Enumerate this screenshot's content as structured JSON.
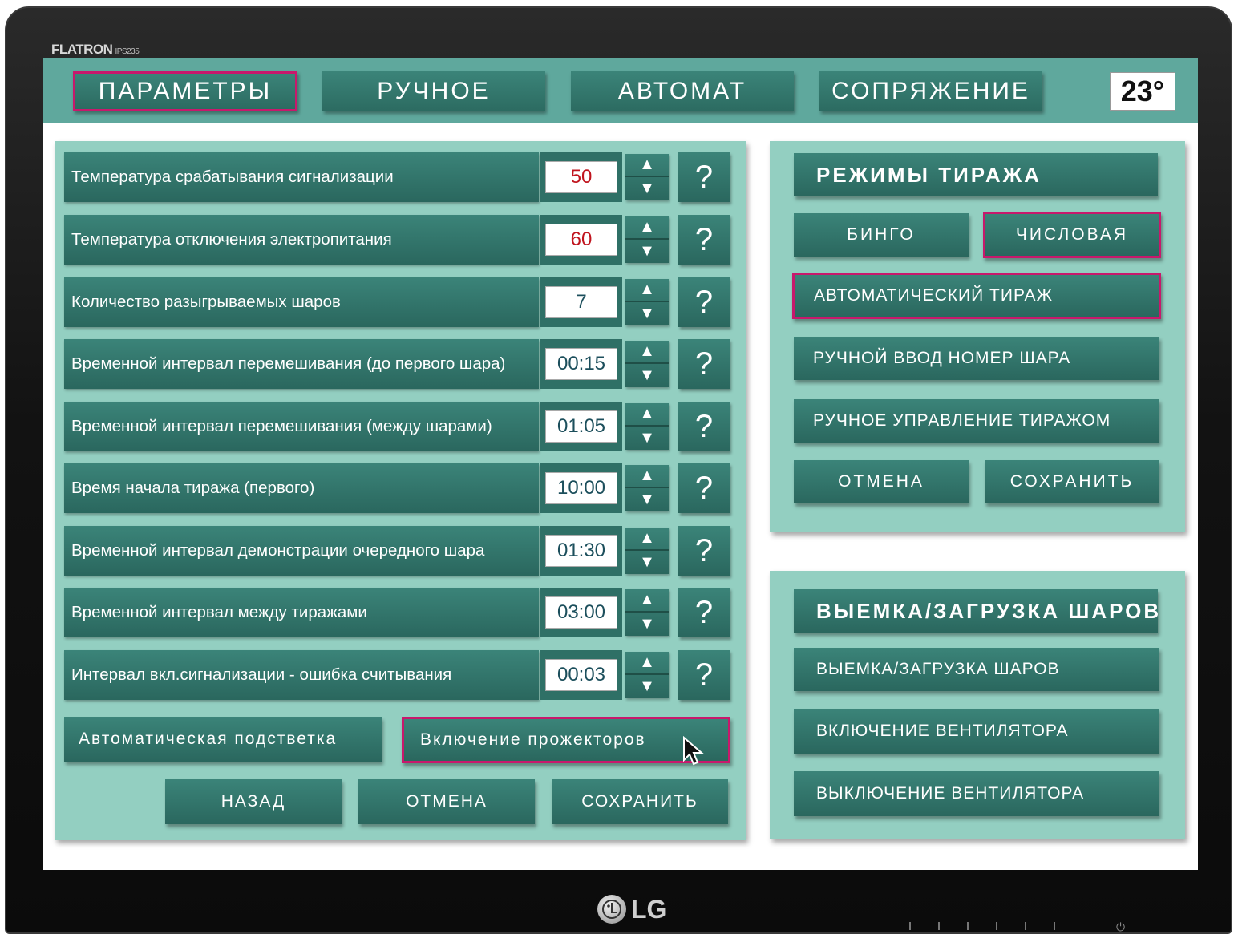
{
  "monitor": {
    "brand": "FLATRON",
    "model": "IPS235",
    "logo_text": "LG"
  },
  "tabs": [
    {
      "label": "ПАРАМЕТРЫ",
      "active": true
    },
    {
      "label": "РУЧНОЕ",
      "active": false
    },
    {
      "label": "АВТОМАТ",
      "active": false
    },
    {
      "label": "СОПРЯЖЕНИЕ",
      "active": false
    }
  ],
  "temperature": "23°",
  "params": [
    {
      "label": "Температура срабатывания сигнализации",
      "value": "50"
    },
    {
      "label": "Температура отключения электропитания",
      "value": "60"
    },
    {
      "label": "Количество разыгрываемых шаров",
      "value": "7"
    },
    {
      "label": "Временной интервал перемешивания (до первого шара)",
      "value": "00:15"
    },
    {
      "label": "Временной интервал перемешивания (между шарами)",
      "value": "01:05"
    },
    {
      "label": "Время начала тиража  (первого)",
      "value": "10:00"
    },
    {
      "label": "Временной интервал демонстрации очередного шара",
      "value": "01:30"
    },
    {
      "label": "Временной интервал между тиражами",
      "value": "03:00"
    },
    {
      "label": "Интервал вкл.сигнализации - ошибка считывания",
      "value": "00:03"
    }
  ],
  "help_label": "?",
  "lighting": {
    "auto_backlight": "Автоматическая подстветка",
    "spotlights_on": "Включение прожекторов"
  },
  "params_actions": {
    "back": "НАЗАД",
    "cancel": "ОТМЕНА",
    "save": "СОХРАНИТЬ"
  },
  "draw_modes": {
    "title": "РЕЖИМЫ ТИРАЖА",
    "bingo": "БИНГО",
    "numeric": "ЧИСЛОВАЯ",
    "auto_draw": "АВТОМАТИЧЕСКИЙ  ТИРАЖ",
    "manual_ball": "РУЧНОЙ ВВОД НОМЕР ШАРА",
    "manual_control": "РУЧНОЕ УПРАВЛЕНИЕ ТИРАЖОМ",
    "cancel": "ОТМЕНА",
    "save": "СОХРАНИТЬ"
  },
  "balls": {
    "title": "ВЫЕМКА/ЗАГРУЗКА ШАРОВ",
    "load_unload": "ВЫЕМКА/ЗАГРУЗКА  ШАРОВ",
    "fan_on": "ВКЛЮЧЕНИЕ ВЕНТИЛЯТОРА",
    "fan_off": "ВЫКЛЮЧЕНИЕ ВЕНТИЛЯТОРА"
  },
  "colors": {
    "panel": "#93cfc1",
    "button": "#2f7066",
    "topbar": "#5fa89d",
    "selected_border": "#c8186c",
    "value_red": "#c0141e"
  },
  "icons": {
    "stepper_up": "arrow-up-icon",
    "stepper_down": "arrow-down-icon",
    "cursor": "mouse-pointer-icon",
    "power": "power-icon"
  }
}
